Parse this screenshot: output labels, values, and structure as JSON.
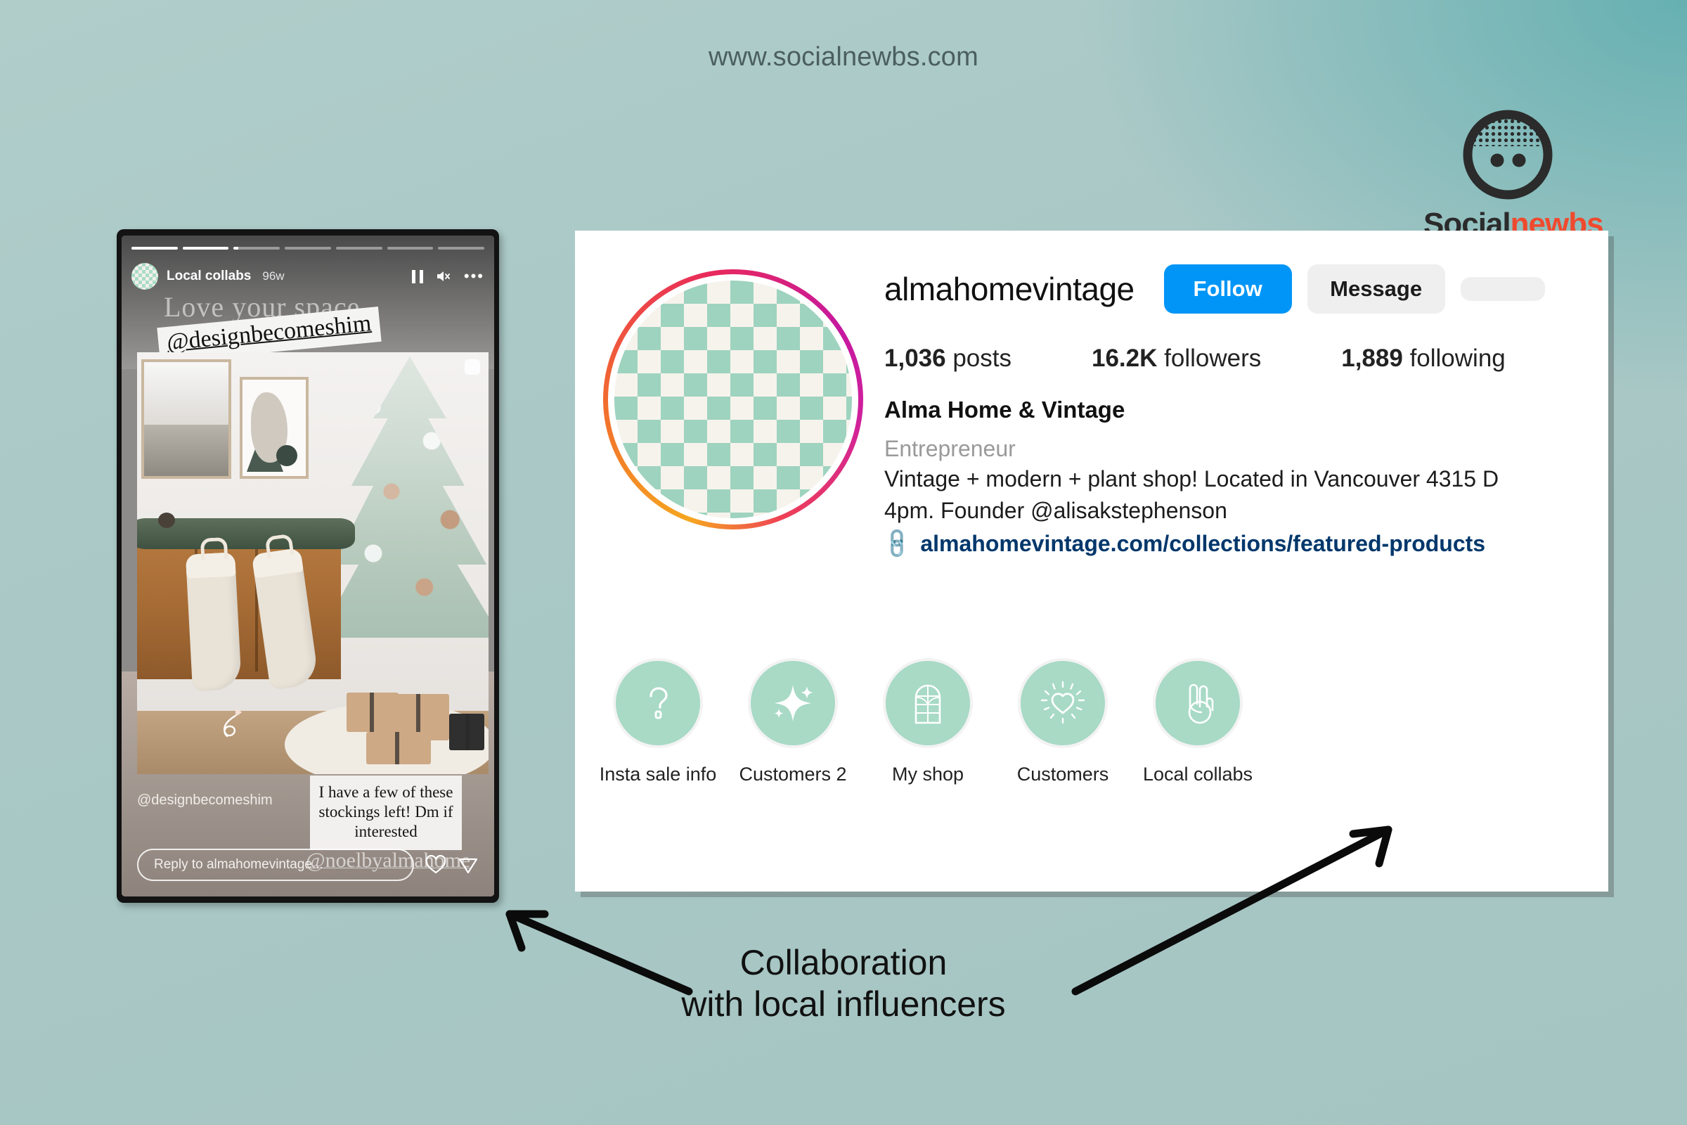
{
  "page": {
    "site_url": "www.socialnewbs.com",
    "background_color": "#a9c8c6",
    "accent_teal": "#6fb3b2"
  },
  "logo": {
    "word_part1": "Social",
    "word_part2": "newbs",
    "color_dark": "#2b2b2b",
    "color_accent": "#ef4a2e",
    "icon": "socialnewbs-face-logo"
  },
  "profile": {
    "username": "almahomevintage",
    "follow_label": "Follow",
    "message_label": "Message",
    "follow_color": "#0095f6",
    "stats": [
      {
        "value": "1,036",
        "label": "posts"
      },
      {
        "value": "16.2K",
        "label": "followers"
      },
      {
        "value": "1,889",
        "label": "following"
      }
    ],
    "full_name": "Alma Home & Vintage",
    "category": "Entrepreneur",
    "bio_line1": "Vintage + modern + plant shop! Located in Vancouver 4315 D",
    "bio_line2": "4pm. Founder @alisakstephenson",
    "link": "almahomevintage.com/collections/featured-products",
    "highlights": [
      {
        "label": "Insta sale info",
        "icon": "question-mark-icon"
      },
      {
        "label": "Customers 2",
        "icon": "sparkle-icon"
      },
      {
        "label": "My shop",
        "icon": "arched-window-icon"
      },
      {
        "label": "Customers",
        "icon": "radiant-heart-icon"
      },
      {
        "label": "Local collabs",
        "icon": "peace-hand-icon"
      }
    ]
  },
  "story": {
    "highlight_name": "Local collabs",
    "age": "96w",
    "watermark_top": "Love your space",
    "handle_tag": "@designbecomeshim",
    "handle_bottom": "@designbecomeshim",
    "dm_text": "I have a few of these stockings left! Dm if interested",
    "watermark_bottom": "@noelbyalmahome",
    "reply_placeholder": "Reply to almahomevintage...",
    "progress_segments": [
      100,
      100,
      10,
      0,
      0,
      0,
      0
    ]
  },
  "annotation": {
    "line1": "Collaboration",
    "line2": "with local influencers"
  }
}
